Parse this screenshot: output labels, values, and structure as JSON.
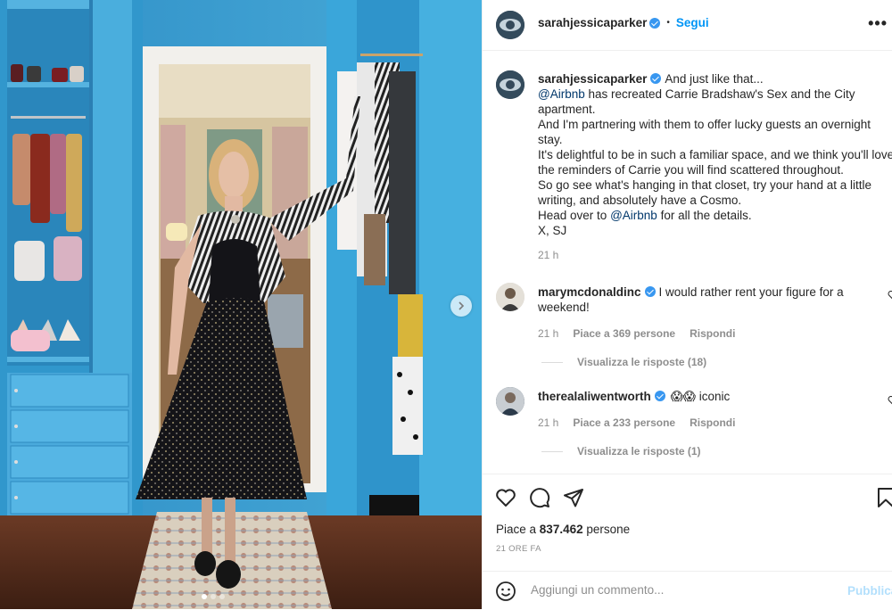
{
  "post": {
    "image_alt_icon": "photo-closet",
    "carousel": {
      "slides": 3,
      "active": 1
    }
  },
  "header": {
    "username": "sarahjessicaparker",
    "separator": "•",
    "follow_label": "Segui",
    "more_label": "•••"
  },
  "caption": {
    "username": "sarahjessicaparker",
    "lines": [
      "And just like that...",
      "has recreated Carrie Bradshaw's Sex and the City",
      "apartment.",
      "And I'm partnering with them to offer lucky guests an overnight",
      "stay.",
      "It's delightful to be in such a familiar space, and we think you'll love",
      "the reminders of Carrie you will find scattered throughout.",
      "So go see what's hanging in that closet, try your hand at a little",
      "writing, and absolutely have a Cosmo.",
      "Head over to",
      "for all the details.",
      "X, SJ"
    ],
    "mention_1": "@Airbnb",
    "mention_2": "@Airbnb",
    "time": "21 h"
  },
  "comments": [
    {
      "username": "marymcdonaldinc",
      "text_line1": "I would rather rent your figure for a",
      "text_line2": "weekend!",
      "time": "21 h",
      "likes": "Piace a 369 persone",
      "reply_label": "Rispondi",
      "view_replies": "Visualizza le risposte (18)"
    },
    {
      "username": "therealaliwentworth",
      "emoji": "😱😱",
      "text": "iconic",
      "time": "21 h",
      "likes": "Piace a 233 persone",
      "reply_label": "Rispondi",
      "view_replies": "Visualizza le risposte (1)"
    }
  ],
  "actions": {
    "likes_prefix": "Piace a",
    "likes_count": "837.462",
    "likes_suffix": "persone",
    "time_ago": "21 ORE FA"
  },
  "add_comment": {
    "placeholder": "Aggiungi un commento...",
    "publish_label": "Pubblica"
  },
  "colors": {
    "accent": "#0095f6",
    "publish_disabled": "#b2dffc",
    "closet_blue": "#3aa0d4"
  },
  "icons": [
    "heart-icon",
    "comment-icon",
    "share-icon",
    "bookmark-icon",
    "emoji-icon",
    "chevron-right-icon",
    "more-icon",
    "verified-icon"
  ]
}
